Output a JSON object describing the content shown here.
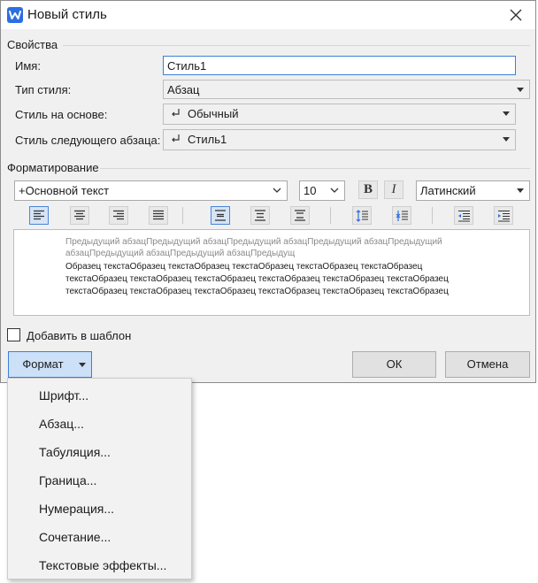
{
  "window": {
    "title": "Новый стиль"
  },
  "properties": {
    "section_label": "Свойства",
    "name_label": "Имя:",
    "name_value": "Стиль1",
    "type_label": "Тип стиля:",
    "type_value": "Абзац",
    "based_on_label": "Стиль на основе:",
    "based_on_value": "Обычный",
    "next_label": "Стиль следующего абзаца:",
    "next_value": "Стиль1"
  },
  "formatting": {
    "section_label": "Форматирование",
    "font_value": "+Основной текст",
    "size_value": "10",
    "bold_glyph": "B",
    "italic_glyph": "I",
    "script_value": "Латинский"
  },
  "preview": {
    "prev_line1": "Предыдущий абзацПредыдущий абзацПредыдущий абзацПредыдущий абзацПредыдущий",
    "prev_line2": "абзацПредыдущий абзацПредыдущий абзацПредыдущ",
    "sample_line1": "Образец текстаОбразец текстаОбразец текстаОбразец текстаОбразец текстаОбразец",
    "sample_line2": "текстаОбразец текстаОбразец текстаОбразец текстаОбразец текстаОбразец текстаОбразец",
    "sample_line3": "текстаОбразец текстаОбразец текстаОбразец текстаОбразец текстаОбразец текстаОбразец"
  },
  "add_to_template": {
    "label": "Добавить в шаблон",
    "checked": false
  },
  "buttons": {
    "format": "Формат",
    "ok": "ОК",
    "cancel": "Отмена"
  },
  "format_menu": {
    "items": [
      "Шрифт...",
      "Абзац...",
      "Табуляция...",
      "Граница...",
      "Нумерация...",
      "Сочетание...",
      "Текстовые эффекты..."
    ]
  },
  "colors": {
    "accent": "#3c7fd8",
    "app_icon": "#2b6fe0",
    "dialog_bg": "#f0f0f0",
    "menu_bg": "#f2f2f2"
  }
}
